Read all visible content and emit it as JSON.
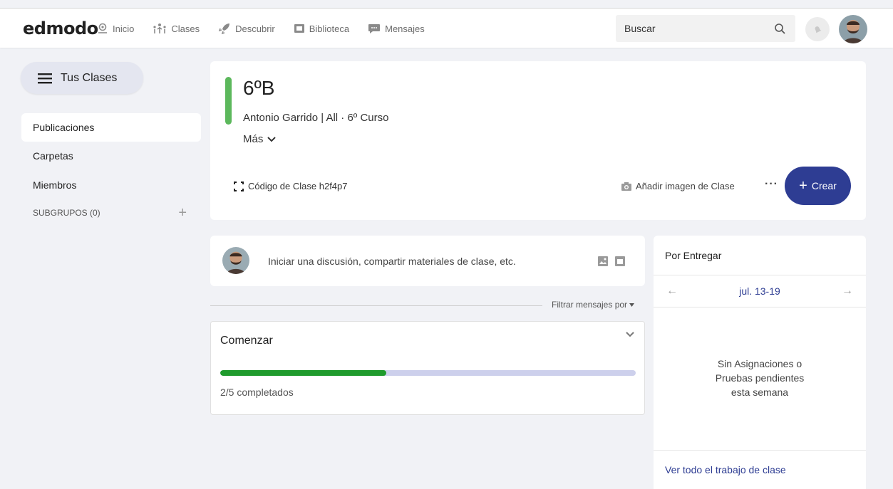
{
  "topbar": {
    "logo": "edmodo",
    "nav": [
      {
        "label": "Inicio",
        "icon": "home-icon"
      },
      {
        "label": "Clases",
        "icon": "classes-icon"
      },
      {
        "label": "Descubrir",
        "icon": "rocket-icon"
      },
      {
        "label": "Biblioteca",
        "icon": "library-icon"
      },
      {
        "label": "Mensajes",
        "icon": "messages-icon"
      }
    ],
    "search_placeholder": "Buscar"
  },
  "sidebar": {
    "toggle_label": "Tus Clases",
    "items": [
      {
        "label": "Publicaciones",
        "active": true
      },
      {
        "label": "Carpetas",
        "active": false
      },
      {
        "label": "Miembros",
        "active": false
      }
    ],
    "subgroups_label": "SUBGRUPOS (0)"
  },
  "class_card": {
    "title": "6ºB",
    "subtitle": "Antonio Garrido | All  · 6º Curso",
    "more_label": "Más",
    "code_label": "Código de Clase h2f4p7",
    "add_image_label": "Añadir imagen de Clase",
    "more_options": "···",
    "create_label": "Crear",
    "accent_color": "#5cb85c"
  },
  "post": {
    "prompt": "Iniciar una discusión, compartir materiales de clase, etc."
  },
  "filter_label": "Filtrar mensajes por",
  "getting_started": {
    "title": "Comenzar",
    "progress_text": "2/5 completados",
    "completed": 2,
    "total": 5
  },
  "due": {
    "header": "Por Entregar",
    "week": "jul. 13-19",
    "empty_text": "Sin Asignaciones o Pruebas pendientes esta semana",
    "link": "Ver todo el trabajo de clase"
  },
  "colors": {
    "primary": "#2e3d93",
    "progress_fill": "#1f9b2d",
    "progress_track": "#cdd0ec",
    "background": "#f1f2f6"
  }
}
